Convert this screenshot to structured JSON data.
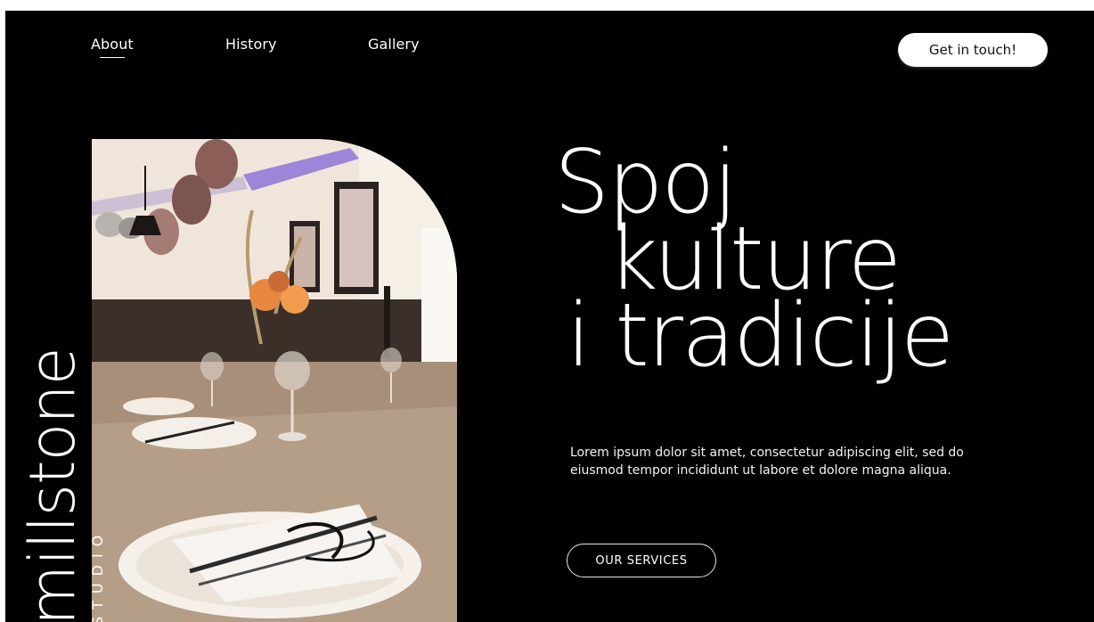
{
  "nav": {
    "items": [
      {
        "label": "About"
      },
      {
        "label": "History"
      },
      {
        "label": "Gallery"
      }
    ],
    "cta_label": "Get in touch!"
  },
  "brand": {
    "name": "millstone",
    "subtitle": "STUDIO"
  },
  "hero": {
    "headline_lines": [
      "Spoj",
      "kulture",
      "i tradicije"
    ],
    "body": "Lorem ipsum dolor sit amet, consectetur adipiscing elit, sed do eiusmod tempor incididunt ut labore et dolore magna aliqua.",
    "button_label": "OUR SERVICES"
  },
  "colors": {
    "background": "#000000",
    "text": "#ffffff",
    "cta_background": "#ffffff"
  },
  "icons": {
    "photo": "dinner-table-photo"
  }
}
